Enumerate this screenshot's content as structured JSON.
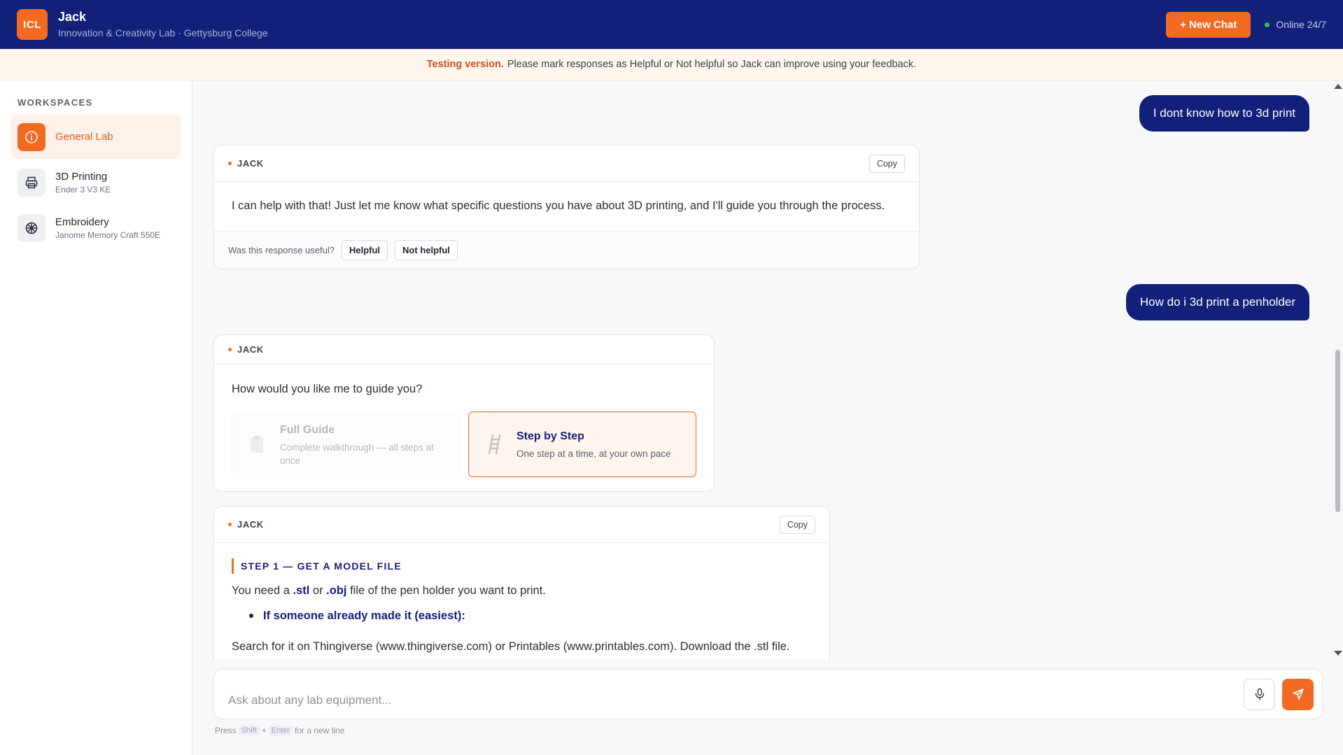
{
  "header": {
    "logo_text": "ICL",
    "title": "Jack",
    "subtitle": "Innovation & Creativity Lab · Gettysburg College",
    "new_chat_label": "+ New Chat",
    "status_text": "Online 24/7"
  },
  "banner": {
    "bold": "Testing version.",
    "text": "Please mark responses as Helpful or Not helpful so Jack can improve using your feedback."
  },
  "sidebar": {
    "section_title": "WORKSPACES",
    "items": [
      {
        "label": "General Lab",
        "sub": "",
        "icon": "info-icon",
        "active": true
      },
      {
        "label": "3D Printing",
        "sub": "Ender 3 V3 KE",
        "icon": "printer-icon",
        "active": false
      },
      {
        "label": "Embroidery",
        "sub": "Janome Memory Craft 550E",
        "icon": "thread-icon",
        "active": false
      }
    ]
  },
  "messages": {
    "user1": "I dont know how to 3d print",
    "bot1": {
      "sender": "JACK",
      "copy_label": "Copy",
      "text": "I can help with that! Just let me know what specific questions you have about 3D printing, and I'll guide you through the process.",
      "feedback_prompt": "Was this response useful?",
      "helpful_label": "Helpful",
      "not_helpful_label": "Not helpful"
    },
    "user2": "How do i 3d print a penholder",
    "bot2": {
      "sender": "JACK",
      "question": "How would you like me to guide you?",
      "choices": [
        {
          "title": "Full Guide",
          "desc": "Complete walkthrough — all steps at once",
          "icon": "clipboard-icon"
        },
        {
          "title": "Step by Step",
          "desc": "One step at a time, at your own pace",
          "icon": "ladder-icon"
        }
      ]
    },
    "bot3": {
      "sender": "JACK",
      "copy_label": "Copy",
      "step_heading": "STEP 1 — GET A MODEL FILE",
      "p1_a": "You need a ",
      "p1_stl": ".stl",
      "p1_b": " or ",
      "p1_obj": ".obj",
      "p1_c": " file of the pen holder you want to print.",
      "bullet": "If someone already made it (easiest):",
      "p2": "Search for it on Thingiverse (www.thingiverse.com) or Printables (www.printables.com). Download the .stl file."
    }
  },
  "composer": {
    "placeholder": "Ask about any lab equipment...",
    "hint_a": "Press",
    "key_shift": "Shift",
    "plus": "+",
    "key_enter": "Enter",
    "hint_b": "for a new line"
  },
  "colors": {
    "brand_navy": "#13207a",
    "accent_orange": "#f26a21",
    "online_green": "#22c55e"
  }
}
